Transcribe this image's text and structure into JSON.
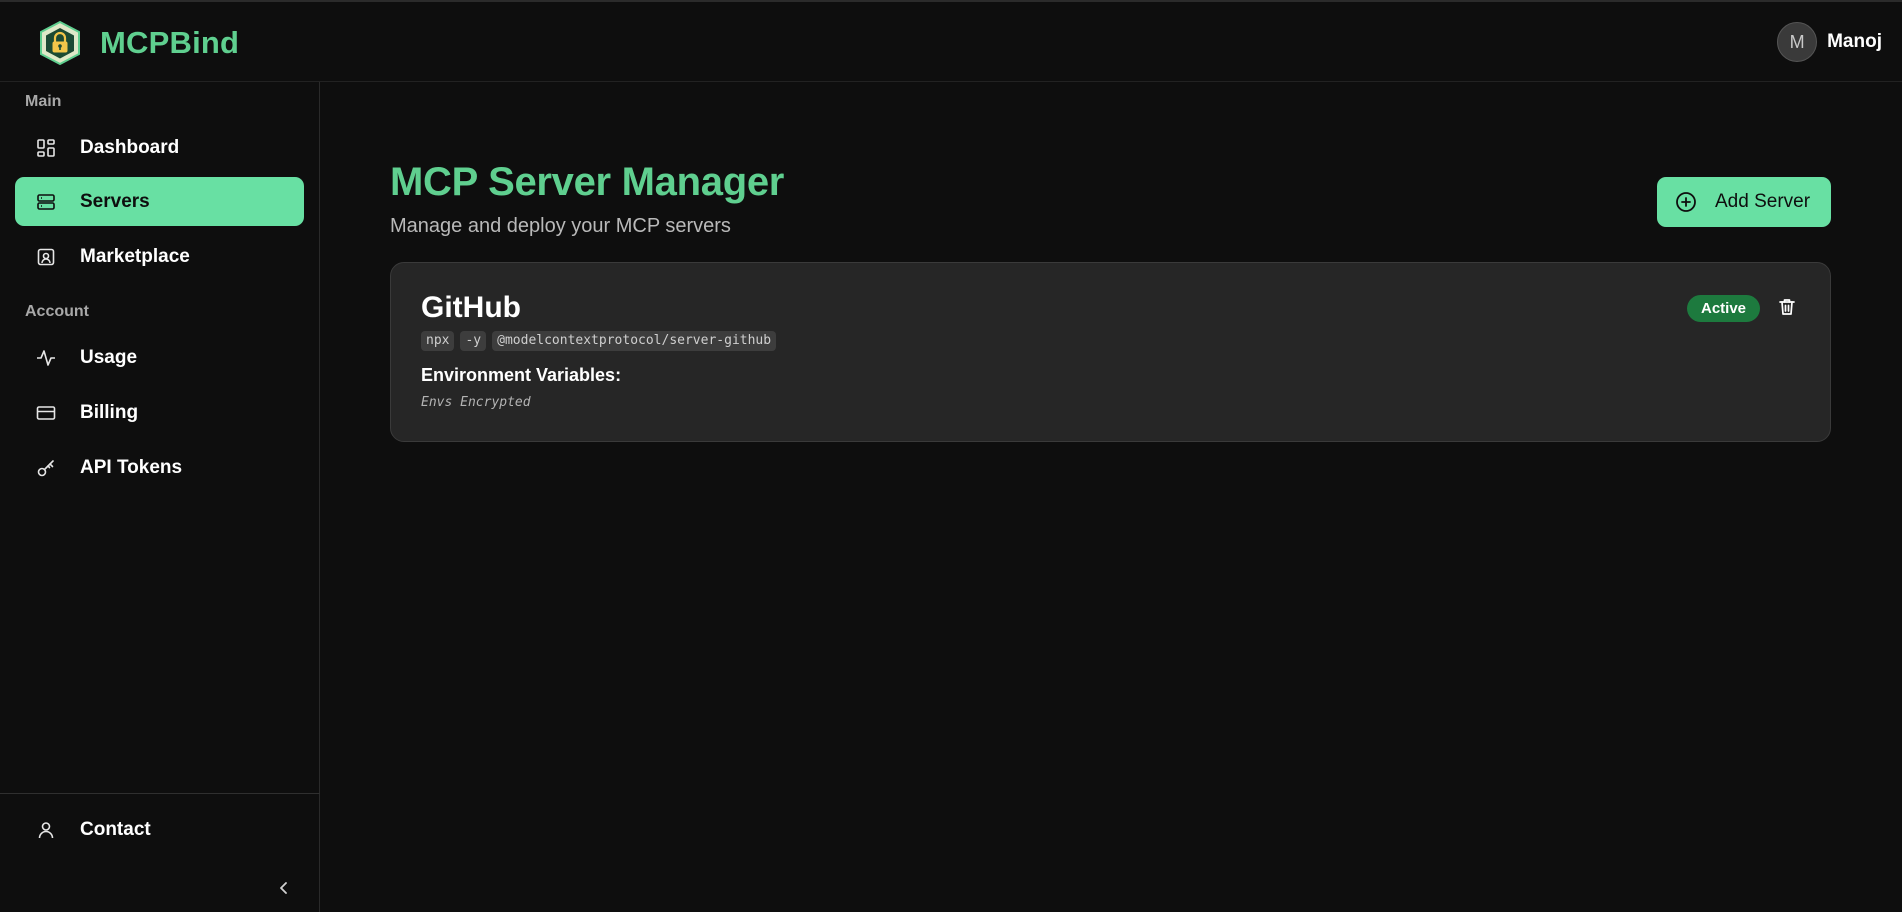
{
  "app": {
    "name": "MCPBind",
    "logo_icon": "lock-shield-logo",
    "accent_color": "#5fcf8f",
    "button_color": "#68e0a3"
  },
  "user": {
    "initial": "M",
    "name": "Manoj"
  },
  "sidebar": {
    "sections": [
      {
        "label": "Main",
        "items": [
          {
            "label": "Dashboard",
            "icon": "dashboard-icon",
            "active": false
          },
          {
            "label": "Servers",
            "icon": "server-icon",
            "active": true
          },
          {
            "label": "Marketplace",
            "icon": "marketplace-icon",
            "active": false
          }
        ]
      },
      {
        "label": "Account",
        "items": [
          {
            "label": "Usage",
            "icon": "activity-icon",
            "active": false
          },
          {
            "label": "Billing",
            "icon": "credit-card-icon",
            "active": false
          },
          {
            "label": "API Tokens",
            "icon": "key-icon",
            "active": false
          }
        ]
      }
    ],
    "footer_item": {
      "label": "Contact",
      "icon": "user-icon"
    },
    "collapse_icon": "chevron-left-icon"
  },
  "main": {
    "title": "MCP Server Manager",
    "subtitle": "Manage and deploy your MCP servers",
    "add_button_label": "Add Server",
    "servers": [
      {
        "name": "GitHub",
        "command_parts": [
          "npx",
          "-y",
          "@modelcontextprotocol/server-github"
        ],
        "env_heading": "Environment Variables:",
        "env_value": "Envs Encrypted",
        "status": "Active",
        "status_color": "#1d7a3e"
      }
    ]
  }
}
